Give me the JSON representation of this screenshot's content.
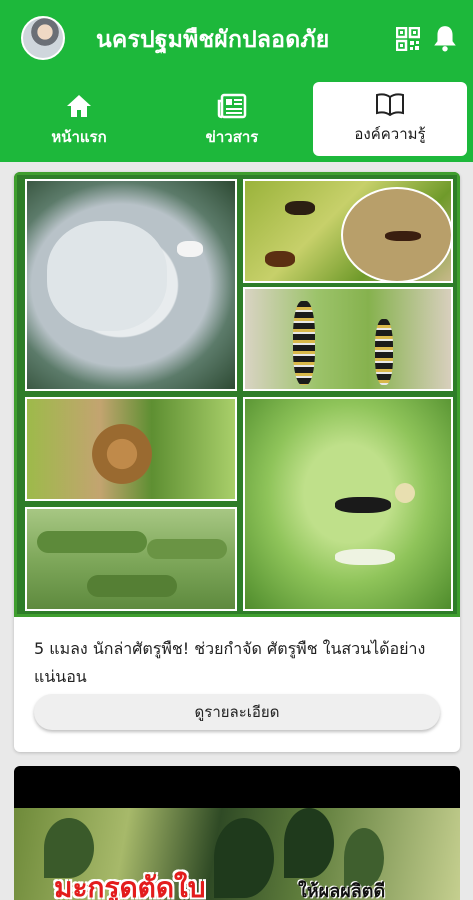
{
  "app": {
    "title": "นครปฐมพืชผักปลอดภัย",
    "icons": [
      "avatar",
      "qr-code-icon",
      "bell-icon"
    ],
    "accent_color": "#1db83b"
  },
  "tabs": [
    {
      "label": "หน้าแรก",
      "icon": "home-icon",
      "active": false
    },
    {
      "label": "ข่าวสาร",
      "icon": "news-icon",
      "active": false
    },
    {
      "label": "องค์ความรู้",
      "icon": "book-icon",
      "active": true
    }
  ],
  "cards": [
    {
      "text": "5 แมลง นักล่าศัตรูพืช! ช่วยกำจัด ศัตรูพืช ในสวนได้อย่างแน่นอน",
      "button_label": "ดูรายละเอียด"
    },
    {
      "overlay_title": "มะกรูดตัดใบ",
      "overlay_sub": "ให้ผลผลิตดี"
    }
  ]
}
